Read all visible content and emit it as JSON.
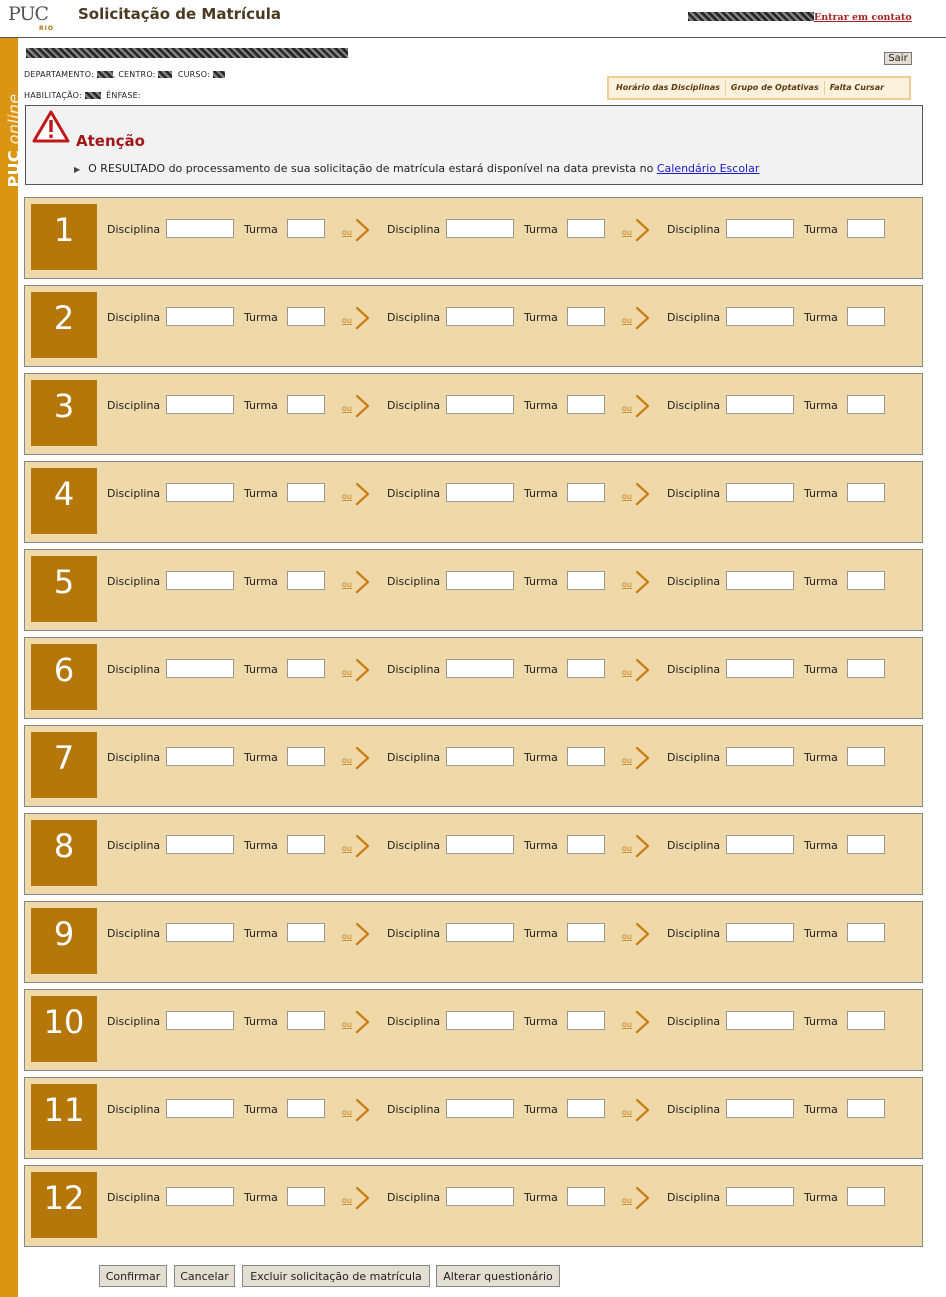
{
  "header": {
    "logo_text": "PUC",
    "logo_sub": "RIO",
    "title": "Solicitação de Matrícula",
    "contact_link": "Entrar em contato"
  },
  "sidebar": {
    "brand": "PUC",
    "brand_suffix": "online"
  },
  "student": {
    "dept_label": "DEPARTAMENTO:",
    "centro_label": "CENTRO:",
    "curso_label": "CURSO:",
    "habilitacao_label": "HABILITAÇÃO:",
    "enfase_label": "ÊNFASE:"
  },
  "actions": {
    "logout": "Sair"
  },
  "quicklinks": [
    "Horário das Disciplinas",
    "Grupo de Optativas",
    "Falta Cursar"
  ],
  "attention": {
    "title": "Atenção",
    "message": "O RESULTADO do processamento de sua solicitação de matrícula estará disponível na data prevista no ",
    "link": "Calendário Escolar"
  },
  "labels": {
    "disciplina": "Disciplina",
    "turma": "Turma",
    "ou": "ou"
  },
  "rows": [
    {
      "number": "1"
    },
    {
      "number": "2"
    },
    {
      "number": "3"
    },
    {
      "number": "4"
    },
    {
      "number": "5"
    },
    {
      "number": "6"
    },
    {
      "number": "7"
    },
    {
      "number": "8"
    },
    {
      "number": "9"
    },
    {
      "number": "10"
    },
    {
      "number": "11"
    },
    {
      "number": "12"
    }
  ],
  "footer_buttons": [
    "Confirmar",
    "Cancelar",
    "Excluir solicitação de matrícula",
    "Alterar questionário"
  ],
  "colors": {
    "accent": "#dc9512",
    "badge": "#b5770a",
    "panel": "#efd9a9",
    "alert_title": "#a01818",
    "link": "#1a1ad0"
  },
  "icons": {
    "warning": "warning-triangle-icon",
    "alternative": "ou-arrow-icon"
  }
}
